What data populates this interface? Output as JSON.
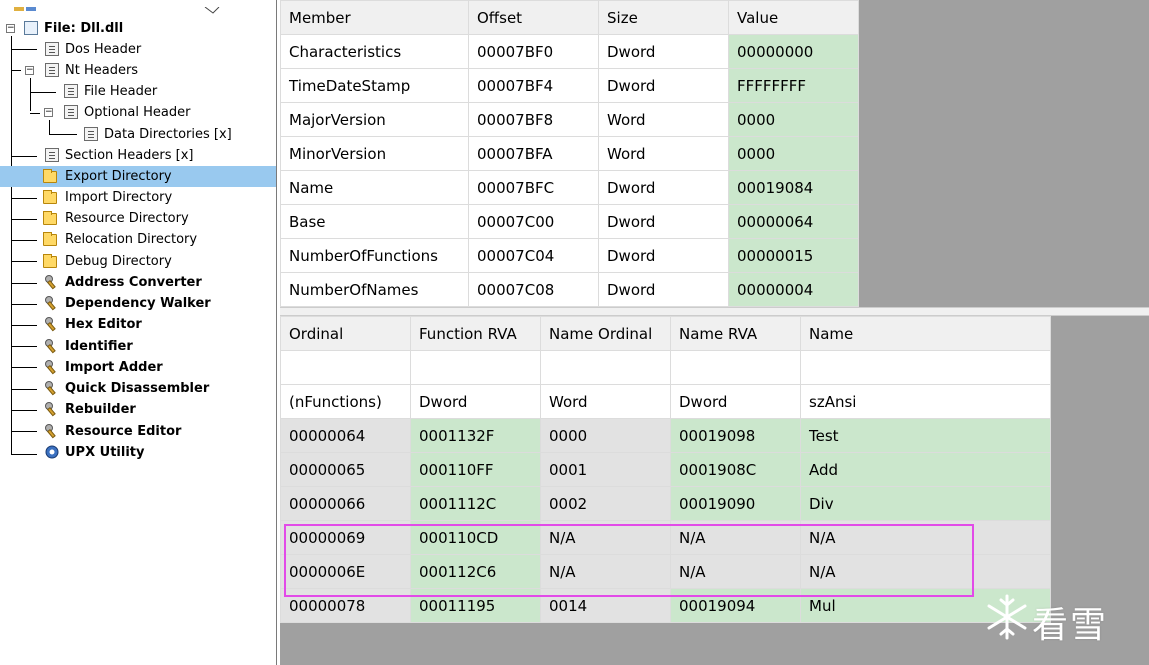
{
  "tree": {
    "root": {
      "label": "File: Dll.dll"
    },
    "items": [
      {
        "label": "Dos Header"
      },
      {
        "label": "Nt Headers"
      },
      {
        "label": "File Header"
      },
      {
        "label": "Optional Header"
      },
      {
        "label": "Data Directories [x]"
      },
      {
        "label": "Section Headers [x]"
      },
      {
        "label": "Export Directory"
      },
      {
        "label": "Import Directory"
      },
      {
        "label": "Resource Directory"
      },
      {
        "label": "Relocation Directory"
      },
      {
        "label": "Debug Directory"
      }
    ],
    "tools": [
      {
        "label": "Address Converter"
      },
      {
        "label": "Dependency Walker"
      },
      {
        "label": "Hex Editor"
      },
      {
        "label": "Identifier"
      },
      {
        "label": "Import Adder"
      },
      {
        "label": "Quick Disassembler"
      },
      {
        "label": "Rebuilder"
      },
      {
        "label": "Resource Editor"
      },
      {
        "label": "UPX Utility"
      }
    ],
    "selected_color": "#99c9ef"
  },
  "members_table": {
    "headers": [
      "Member",
      "Offset",
      "Size",
      "Value"
    ],
    "rows": [
      [
        "Characteristics",
        "00007BF0",
        "Dword",
        "00000000"
      ],
      [
        "TimeDateStamp",
        "00007BF4",
        "Dword",
        "FFFFFFFF"
      ],
      [
        "MajorVersion",
        "00007BF8",
        "Word",
        "0000"
      ],
      [
        "MinorVersion",
        "00007BFA",
        "Word",
        "0000"
      ],
      [
        "Name",
        "00007BFC",
        "Dword",
        "00019084"
      ],
      [
        "Base",
        "00007C00",
        "Dword",
        "00000064"
      ],
      [
        "NumberOfFunctions",
        "00007C04",
        "Dword",
        "00000015"
      ],
      [
        "NumberOfNames",
        "00007C08",
        "Dword",
        "00000004"
      ]
    ]
  },
  "exports_table": {
    "headers": [
      "Ordinal",
      "Function RVA",
      "Name Ordinal",
      "Name RVA",
      "Name"
    ],
    "types": [
      "(nFunctions)",
      "Dword",
      "Word",
      "Dword",
      "szAnsi"
    ],
    "rows": [
      [
        "00000064",
        "0001132F",
        "0000",
        "00019098",
        "Test"
      ],
      [
        "00000065",
        "000110FF",
        "0001",
        "0001908C",
        "Add"
      ],
      [
        "00000066",
        "0001112C",
        "0002",
        "00019090",
        "Div"
      ],
      [
        "00000069",
        "000110CD",
        "N/A",
        "N/A",
        "N/A"
      ],
      [
        "0000006E",
        "000112C6",
        "N/A",
        "N/A",
        "N/A"
      ],
      [
        "00000078",
        "00011195",
        "0014",
        "00019094",
        "Mul"
      ]
    ]
  },
  "colors": {
    "value_green": "#cbe7cc",
    "header_gray": "#f0f0f0",
    "highlight_magenta": "#e24ae8",
    "pane_background": "#a0a0a0"
  },
  "watermark": {
    "text": "看雪"
  }
}
